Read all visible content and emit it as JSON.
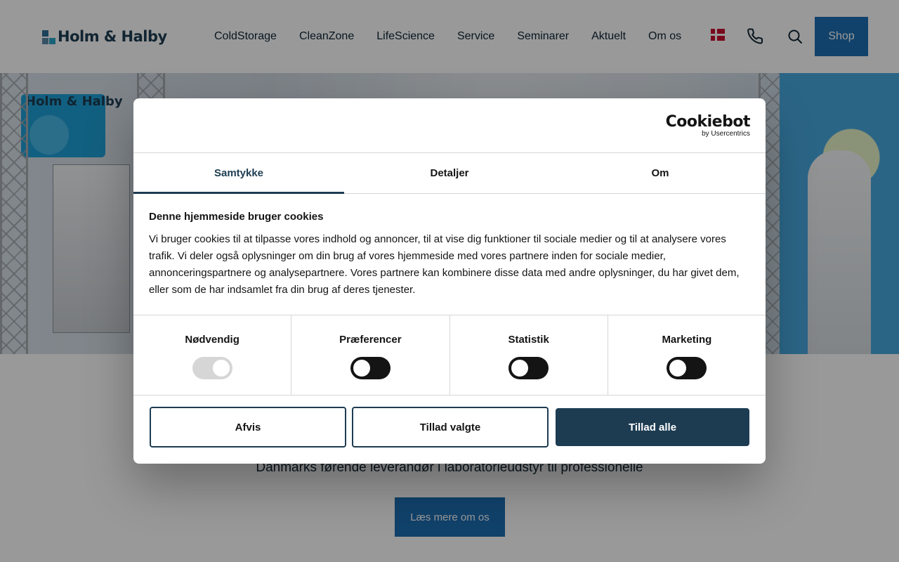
{
  "header": {
    "logo_text": "Holm & Halby",
    "nav": [
      "ColdStorage",
      "CleanZone",
      "LifeScience",
      "Service",
      "Seminarer",
      "Aktuelt",
      "Om os"
    ],
    "shop_label": "Shop"
  },
  "hero": {
    "sign_text": "Holm & Halby"
  },
  "main": {
    "tagline": "Danmarks førende leverandør i laboratorieudstyr til professionelle",
    "more_label": "Læs mere om os"
  },
  "cookie": {
    "brand_name": "Cookiebot",
    "brand_sub": "by Usercentrics",
    "tabs": [
      "Samtykke",
      "Detaljer",
      "Om"
    ],
    "active_tab": "Samtykke",
    "title": "Denne hjemmeside bruger cookies",
    "text": "Vi bruger cookies til at tilpasse vores indhold og annoncer, til at vise dig funktioner til sociale medier og til at analysere vores trafik. Vi deler også oplysninger om din brug af vores hjemmeside med vores partnere inden for sociale medier, annonceringspartnere og analysepartnere. Vores partnere kan kombinere disse data med andre oplysninger, du har givet dem, eller som de har indsamlet fra din brug af deres tjenester.",
    "categories": [
      {
        "label": "Nødvendig",
        "enabled": true,
        "locked": true
      },
      {
        "label": "Præferencer",
        "enabled": false,
        "locked": false
      },
      {
        "label": "Statistik",
        "enabled": false,
        "locked": false
      },
      {
        "label": "Marketing",
        "enabled": false,
        "locked": false
      }
    ],
    "buttons": {
      "reject": "Afvis",
      "allow_selected": "Tillad valgte",
      "allow_all": "Tillad alle"
    }
  },
  "colors": {
    "primary_blue": "#1d6fb3",
    "navy": "#1d3c52",
    "toggle_off": "#141414"
  },
  "icons": {
    "phone": "phone-icon",
    "search": "search-icon",
    "flag": "danish-flag-icon"
  }
}
